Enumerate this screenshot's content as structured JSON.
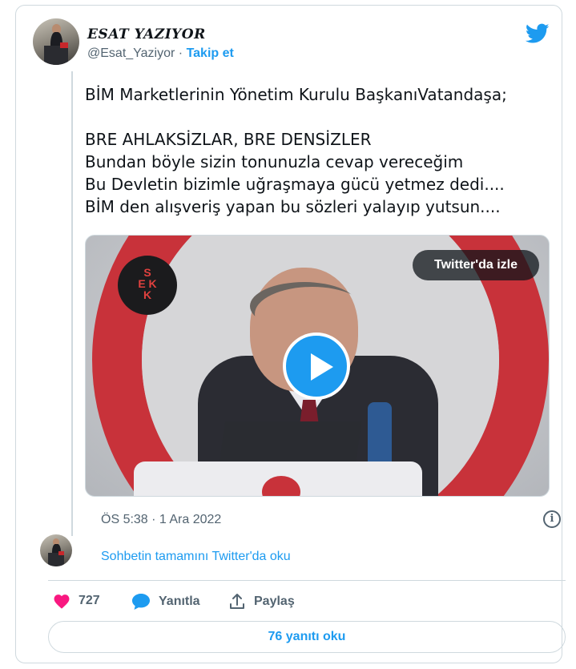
{
  "colors": {
    "accent": "#1d9bf0",
    "secondary_text": "#536471",
    "border": "#cfd9de",
    "like": "#f91880"
  },
  "author": {
    "display_name": "ESAT YAZIYOR",
    "handle": "@Esat_Yaziyor",
    "separator": "·",
    "follow_label": "Takip et"
  },
  "tweet": {
    "lines": [
      "BİM Marketlerinin Yönetim Kurulu BaşkanıVatandaşa;",
      "",
      "BRE AHLAKSİZLAR, BRE DENSİZLER",
      "Bundan böyle sizin tonunuzla cevap vereceğim",
      "Bu Devletin bizimle uğraşmaya gücü yetmez dedi....",
      "BİM den alışveriş yapan bu sözleri yalayıp yutsun...."
    ]
  },
  "video": {
    "watermark_text": [
      "S",
      "E K",
      "K"
    ],
    "watch_label": "Twitter'da izle",
    "play_icon": "play-icon"
  },
  "meta": {
    "timestamp": "ÖS 5:38 · 1 Ara 2022",
    "info_icon": "info-icon"
  },
  "conversation": {
    "label": "Sohbetin tamamını Twitter'da oku"
  },
  "actions": {
    "like_count": "727",
    "reply_label": "Yanıtla",
    "share_label": "Paylaş"
  },
  "footer": {
    "read_replies_label": "76 yanıtı oku"
  }
}
